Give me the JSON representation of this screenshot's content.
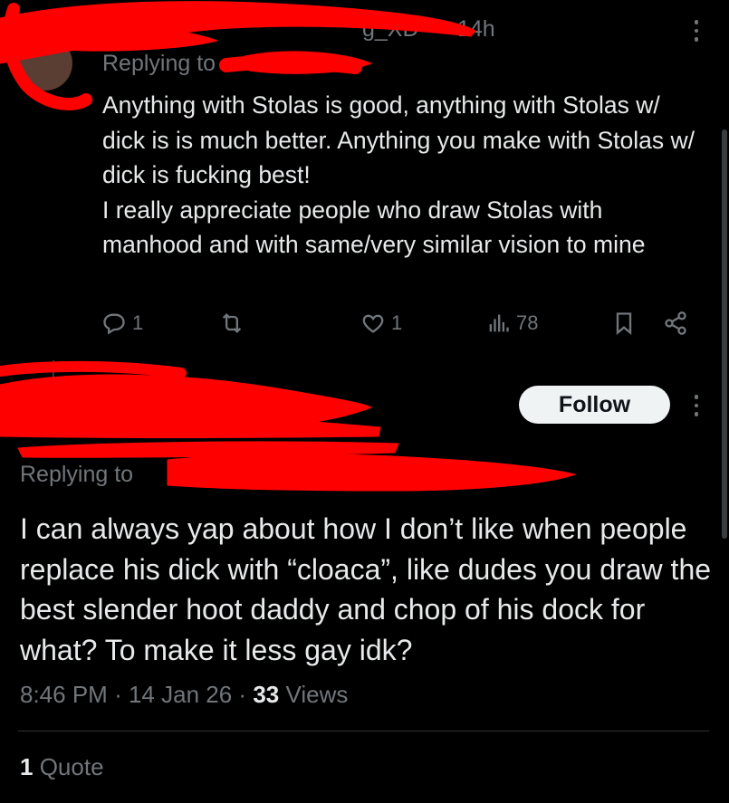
{
  "colors": {
    "background": "#000000",
    "text": "#e7e9ea",
    "muted": "#71767b",
    "redaction": "#ff0000",
    "follow_bg": "#eff3f4"
  },
  "reply_tweet": {
    "handle_fragment": "g_XD",
    "time": "14h",
    "replying_to": "Replying to",
    "text": "Anything with Stolas is good, anything with Stolas w/ dick is is much better. Anything you make with Stolas w/ dick is fucking best!\nI really appreciate people who draw Stolas with manhood and with same/very similar vision to mine",
    "actions": {
      "reply_count": "1",
      "retweet_count": "",
      "like_count": "1",
      "views_count": "78"
    },
    "icons": [
      "reply-icon",
      "retweet-icon",
      "like-icon",
      "views-icon",
      "bookmark-icon",
      "share-icon",
      "more-icon"
    ]
  },
  "main_tweet": {
    "follow_label": "Follow",
    "replying_to": "Replying to",
    "text": "I can always yap about how I don’t like when people replace his dick with “cloaca”, like dudes you draw the best slender hoot daddy and chop of his dock for what? To make it less gay idk?",
    "time": "8:46 PM",
    "date": "14 Jan 26",
    "separator": "·",
    "views_count": "33",
    "views_label": "Views",
    "quote_count": "1",
    "quote_label": "Quote"
  }
}
